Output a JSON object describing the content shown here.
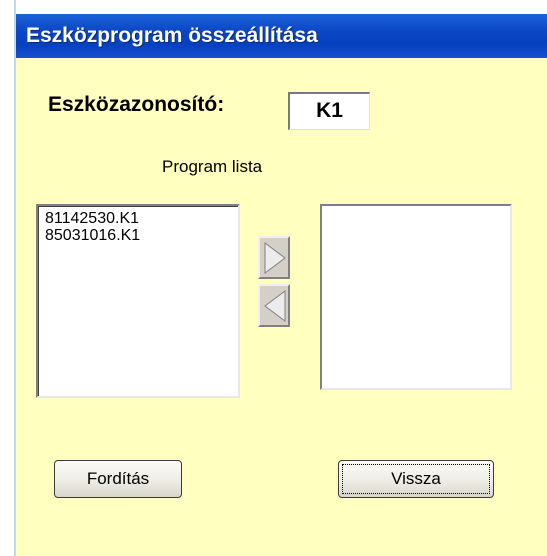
{
  "window": {
    "title": "Eszközprogram összeállítása"
  },
  "device": {
    "label": "Eszközazonosító:",
    "value": "K1"
  },
  "program_list": {
    "label": "Program lista",
    "items": [
      "81142530.K1",
      "85031016.K1"
    ]
  },
  "selected_list": {
    "items": []
  },
  "buttons": {
    "compile_label": "Fordítás",
    "back_label": "Vissza"
  },
  "colors": {
    "background": "#ffffc0",
    "titlebar": "#0a46c4"
  },
  "icons": {
    "add": "triangle-right-icon",
    "remove": "triangle-left-icon"
  }
}
